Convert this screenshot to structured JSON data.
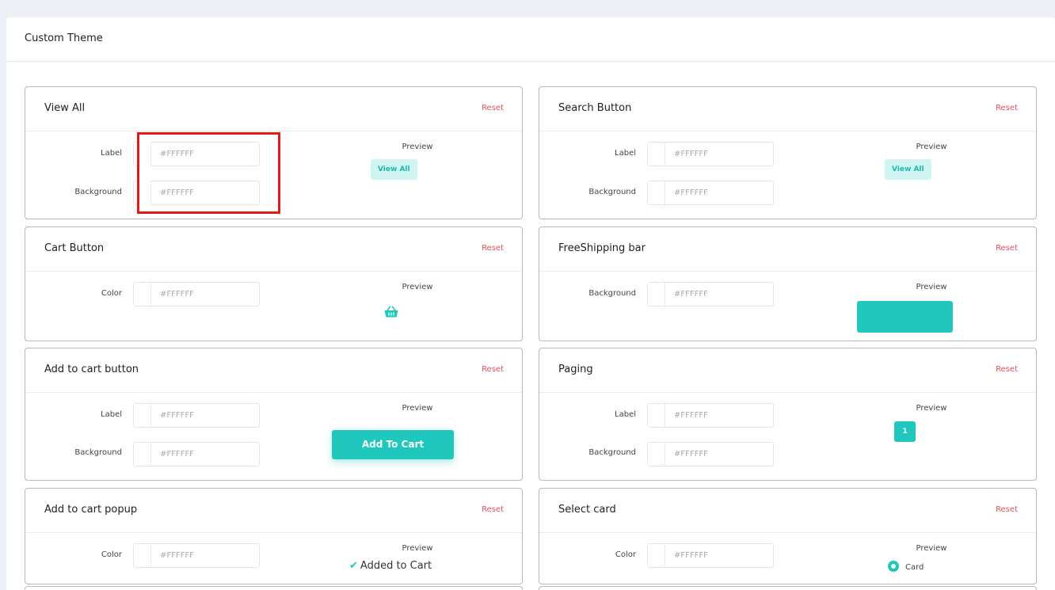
{
  "page": {
    "title": "Custom Theme"
  },
  "common": {
    "preview_label": "Preview",
    "reset_label": "Reset",
    "color_placeholder": "#FFFFFF"
  },
  "panels": {
    "view_all": {
      "title": "View All",
      "fields": [
        "Label",
        "Background"
      ],
      "preview_text": "View All"
    },
    "search_button": {
      "title": "Search Button",
      "fields": [
        "Label",
        "Background"
      ],
      "preview_text": "View All"
    },
    "cart_button": {
      "title": "Cart Button",
      "fields": [
        "Color"
      ],
      "preview_icon": "basket-icon"
    },
    "freeshipping_bar": {
      "title": "FreeShipping bar",
      "fields": [
        "Background"
      ]
    },
    "add_to_cart_button": {
      "title": "Add to cart button",
      "fields": [
        "Label",
        "Background"
      ],
      "preview_text": "Add To Cart"
    },
    "paging": {
      "title": "Paging",
      "fields": [
        "Label",
        "Background"
      ],
      "preview_text": "1"
    },
    "add_to_cart_popup": {
      "title": "Add to cart popup",
      "fields": [
        "Color"
      ],
      "preview_icon": "check-icon",
      "preview_text": "Added to Cart"
    },
    "select_card": {
      "title": "Select card",
      "fields": [
        "Color"
      ],
      "preview_icon": "radio-selected-icon",
      "preview_text": "Card"
    }
  },
  "colors": {
    "accent": "#1fc7bd",
    "accent_light": "#cff5f3",
    "reset_red": "#e0525a",
    "highlight_red": "#e01b1b"
  }
}
